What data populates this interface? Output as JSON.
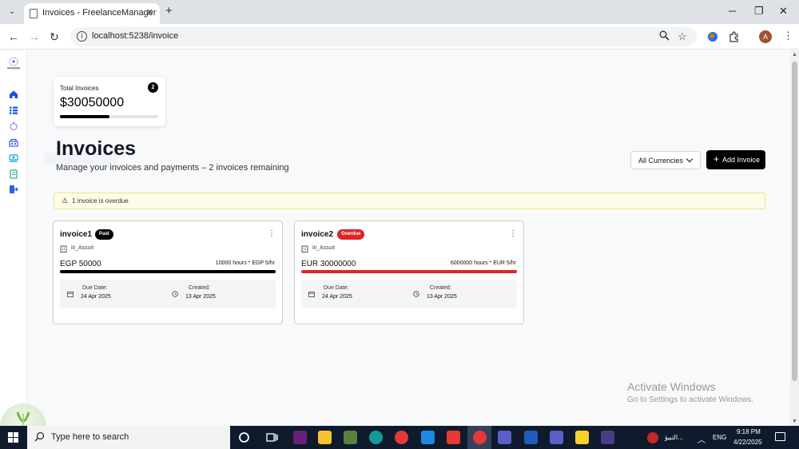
{
  "browser": {
    "tab_title": "Invoices - FreelanceManager",
    "url": "localhost:5238/invoice",
    "profile_initial": "A"
  },
  "summary": {
    "label": "Total Invoices",
    "count": "2",
    "value": "$30050000",
    "progress_fraction": 0.5
  },
  "header": {
    "title": "Invoices",
    "subtitle": "Manage your invoices and payments – 2 invoices remaining",
    "currency_filter": "All Currencies",
    "add_button": "Add Invoice"
  },
  "alert": {
    "text": "1 invoice is overdue"
  },
  "invoices": [
    {
      "name": "invoice1",
      "status": "Paid",
      "status_color": "#000000",
      "client": "iti_Assuit",
      "amount": "EGP 50000",
      "rate": "10000 hours * EGP 5/hr",
      "line_color": "#000000",
      "due_label": "Due Date:",
      "due_date": "24 Apr 2025",
      "created_label": "Created:",
      "created_date": "13 Apr 2025"
    },
    {
      "name": "invoice2",
      "status": "Overdue",
      "status_color": "#dc2626",
      "client": "iti_Assuit",
      "amount": "EUR 30000000",
      "rate": "6000000 hours * EUR 5/hr",
      "line_color": "#dc2626",
      "due_label": "Due Date:",
      "due_date": "24 Apr 2025",
      "created_label": "Created:",
      "created_date": "13 Apr 2025"
    }
  ],
  "watermark": {
    "line1": "Activate Windows",
    "line2": "Go to Settings to activate Windows."
  },
  "taskbar": {
    "search_placeholder": "Type here to search",
    "tray_lang_label": "التبيؤ...",
    "input_lang": "ENG",
    "time": "9:18 PM",
    "date": "4/22/2025"
  },
  "icons": {
    "sidebar": [
      "home-icon",
      "list-icon",
      "project-icon",
      "clients-icon",
      "payments-icon",
      "invoice-icon",
      "logout-icon"
    ]
  }
}
